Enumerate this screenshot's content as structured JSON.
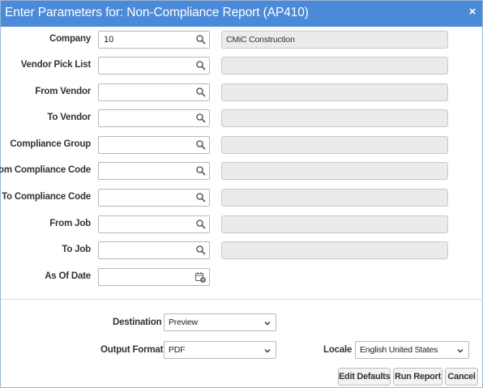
{
  "dialog": {
    "title": "Enter Parameters for: Non-Compliance Report (AP410)",
    "close_symbol": "×"
  },
  "params": [
    {
      "label": "Company",
      "value": "10",
      "description": "CMiC Construction",
      "icon": "search-icon"
    },
    {
      "label": "Vendor Pick List",
      "value": "",
      "description": "",
      "icon": "search-icon"
    },
    {
      "label": "From Vendor",
      "value": "",
      "description": "",
      "icon": "search-icon"
    },
    {
      "label": "To Vendor",
      "value": "",
      "description": "",
      "icon": "search-icon"
    },
    {
      "label": "Compliance Group",
      "value": "",
      "description": "",
      "icon": "search-icon"
    },
    {
      "label": "From Compliance Code",
      "value": "",
      "description": "",
      "icon": "search-icon"
    },
    {
      "label": "To Compliance Code",
      "value": "",
      "description": "",
      "icon": "search-icon"
    },
    {
      "label": "From Job",
      "value": "",
      "description": "",
      "icon": "search-icon"
    },
    {
      "label": "To Job",
      "value": "",
      "description": "",
      "icon": "search-icon"
    }
  ],
  "as_of_date": {
    "label": "As Of Date",
    "value": "",
    "icon": "calendar-icon"
  },
  "output": {
    "destination_label": "Destination",
    "destination_value": "Preview",
    "format_label": "Output Format",
    "format_value": "PDF",
    "locale_label": "Locale",
    "locale_value": "English United States"
  },
  "buttons": {
    "edit_defaults": "Edit Defaults",
    "run_report": "Run Report",
    "cancel": "Cancel"
  },
  "colors": {
    "titlebar": "#4a8ad8",
    "readonly_field": "#ebebeb"
  }
}
